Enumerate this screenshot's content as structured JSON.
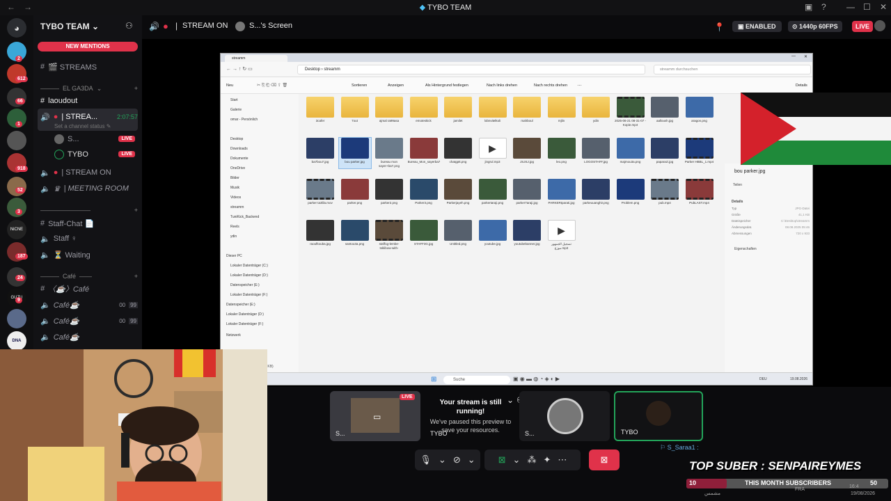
{
  "window": {
    "title": "TYBO TEAM",
    "back": "←",
    "forward": "→",
    "min": "—",
    "max": "☐",
    "close": "✕"
  },
  "guild_badges": [
    "2",
    "612",
    "66",
    "1",
    "918",
    "52",
    "3",
    "1",
    "187",
    "24",
    "9"
  ],
  "guild_letters": {
    "nicne": "NiCNE",
    "guzu": "GUZU",
    "dna": "DNA"
  },
  "server": {
    "name": "TYBO TEAM",
    "new_mentions": "NEW MENTIONS"
  },
  "channels": {
    "streams": "🎬 STREAMS",
    "el_gada_category": "EL GA3DA",
    "laoudout": "laoudout",
    "stream_active": "| STREA...",
    "stream_time": "2:07:57",
    "set_status": "Set a channel status",
    "user_s": "S...",
    "user_tybo": "TYBO",
    "live": "LIVE",
    "stream_on": "| STREAM ON",
    "meeting_room": "| MEETING ROOM",
    "staff_chat": "Staff-Chat 📄",
    "staff": "Staff ♀",
    "waiting": "⏳ Waiting",
    "cafe_category": "Café",
    "cafe_main": "〈☕〉Café",
    "cafe1": "Café☕",
    "cafe2": "Café☕",
    "cafe3": "Café☕",
    "cafe_count_a": "00",
    "cafe_count_b": "99"
  },
  "topbar": {
    "stream_on": "STREAM ON",
    "screen": "S...'s Screen",
    "enabled": "ENABLED",
    "quality": "1440p 60FPS",
    "live": "LIVE"
  },
  "explorer": {
    "tab": "streamm",
    "address_desktop": "Desktop",
    "address_folder": "streamm",
    "search_placeholder": "streamm durchsuchen",
    "toolbar": [
      "Neu",
      "Sortieren",
      "Anzeigen",
      "Als Hintergrund festlegen",
      "Nach links drehen",
      "Nach rechts drehen",
      "…",
      "Details"
    ],
    "sidebar": [
      "Start",
      "Galerie",
      "omar - Persönlich",
      "Desktop",
      "Downloads",
      "Dokumente",
      "OneDrive",
      "Bilder",
      "Musik",
      "Videos",
      "streamm",
      "TuniKick_Backend",
      "Reels",
      "ydin",
      "Dieser PC",
      "Lokaler Datenträger (C:)",
      "Lokaler Datenträger (D:)",
      "Datenspeicher (E:)",
      "Lokaler Datenträger (F:)",
      "Datenspeicher (E:)",
      "Lokaler Datenträger (D:)",
      "Lokaler Datenträger (F:)",
      "Netzwerk"
    ],
    "files": [
      {
        "name": "3cafer",
        "kind": "folder"
      },
      {
        "name": "7out",
        "kind": "folder"
      },
      {
        "name": "ajmal ra99asa",
        "kind": "folder"
      },
      {
        "name": "emoteskick",
        "kind": "folder"
      },
      {
        "name": "jamilet",
        "kind": "folder"
      },
      {
        "name": "lobnvitelkoli",
        "kind": "folder"
      },
      {
        "name": "mahboul",
        "kind": "folder"
      },
      {
        "name": "mjlin",
        "kind": "folder"
      },
      {
        "name": "ydin",
        "kind": "folder"
      },
      {
        "name": "2025-06-21 08-31-07 - Kopie.mp4",
        "kind": "video"
      },
      {
        "name": "aalloush.jpg",
        "kind": "image"
      },
      {
        "name": "aragon.png",
        "kind": "image"
      },
      {
        "name": "ba7bou7.jpg",
        "kind": "image"
      },
      {
        "name": "bou parker.jpg",
        "kind": "image"
      },
      {
        "name": "bureau mon sayer+ba7.png",
        "kind": "image"
      },
      {
        "name": "Bureau_Mon_sayerba7_1.jpg",
        "kind": "image"
      },
      {
        "name": "chatgptt.png",
        "kind": "image"
      },
      {
        "name": "jingrul.mp3",
        "kind": "audio"
      },
      {
        "name": "JSJSJ.jpg",
        "kind": "image"
      },
      {
        "name": "leo.png",
        "kind": "image"
      },
      {
        "name": "LOGOSTAFF.jpg",
        "kind": "image"
      },
      {
        "name": "majmou3a.png",
        "kind": "image"
      },
      {
        "name": "paparazi.jpg",
        "kind": "image"
      },
      {
        "name": "Parker HBBL_1.mp4",
        "kind": "video"
      },
      {
        "name": "parker ta3lila.mov",
        "kind": "video"
      },
      {
        "name": "parker.png",
        "kind": "image"
      },
      {
        "name": "parker2.png",
        "kind": "image"
      },
      {
        "name": "Parker3.png",
        "kind": "image"
      },
      {
        "name": "Parkerjayeh.png",
        "kind": "image"
      },
      {
        "name": "parkertaraji.png",
        "kind": "image"
      },
      {
        "name": "parker7araji.jpg",
        "kind": "image"
      },
      {
        "name": "PARKERtparati.jpg",
        "kind": "image"
      },
      {
        "name": "parkeuuanghir.png",
        "kind": "image"
      },
      {
        "name": "Problem.png",
        "kind": "image"
      },
      {
        "name": "pub.mp4",
        "kind": "video"
      },
      {
        "name": "PubLAST.mp4",
        "kind": "video"
      },
      {
        "name": "raoufkouba.jpg",
        "kind": "image"
      },
      {
        "name": "santou3a.png",
        "kind": "image"
      },
      {
        "name": "staff1g-lembe-tsklibow-with-parker_seifddine-el-grande-jugsdor...",
        "kind": "video"
      },
      {
        "name": "STAFF3G.jpg",
        "kind": "image"
      },
      {
        "name": "Untitled.png",
        "kind": "image"
      },
      {
        "name": "youtube.jpg",
        "kind": "image"
      },
      {
        "name": "youtubebanner.jpg",
        "kind": "image"
      },
      {
        "name": "تسجيل الجمهور موزع.mp3",
        "kind": "audio"
      }
    ],
    "details": {
      "file": "bou parker.jpg",
      "share": "Teilen",
      "section": "Details",
      "rows": [
        [
          "Typ",
          "JPG-Datei"
        ],
        [
          "Größe",
          "41,1 KB"
        ],
        [
          "Dateispeicher",
          "C:\\Desktop\\streamm"
        ],
        [
          "Änderungsdat.",
          "08.08.2025 05:46"
        ],
        [
          "Abmessungen",
          "720 x 933"
        ]
      ],
      "props": "Eigenschaften"
    },
    "status": "1 Element ausgewählt (41,1 KB)",
    "taskbar": {
      "search": "Suche",
      "lang": "DEU",
      "time": "19.08.2026"
    }
  },
  "preview": {
    "tile1_label": "S...",
    "tile1_live": "LIVE",
    "running_title": "Your stream is still running!",
    "running_body": "We've paused this preview to save your resources.",
    "tile2_label": "TYBO",
    "tile3_label": "S...",
    "tile4_label": "TYBO"
  },
  "overlay": {
    "chat_user": "S_Saraa1 :",
    "top_suber": "TOP SUBER : SENPAIREYMES",
    "subs_left": "10",
    "subs_title": "THIS MONTH SUBSCRIBERS",
    "subs_right": "50",
    "clock": "16:4",
    "date": "19/08/2026",
    "lang": "FRA",
    "arabic": "مشمس"
  },
  "colors": {
    "live": "#e0324a",
    "accent": "#23a55a",
    "bg": "#0b0b0d",
    "folder": "#f1c34f"
  }
}
